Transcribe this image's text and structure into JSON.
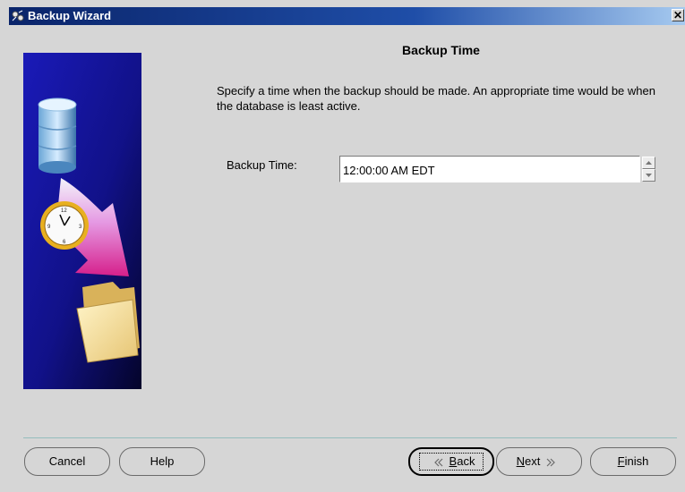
{
  "window": {
    "title": "Backup Wizard",
    "close_glyph": "✕"
  },
  "page": {
    "title": "Backup Time",
    "instructions": "Specify a time when the backup should be made. An appropriate time would be when the database is least active."
  },
  "backup_time": {
    "label": "Backup Time:",
    "value": "12:00:00 AM EDT"
  },
  "buttons": {
    "cancel": "Cancel",
    "help": "Help",
    "back": {
      "mnemonic": "B",
      "rest": "ack"
    },
    "next": {
      "mnemonic": "N",
      "rest": "ext"
    },
    "finish": {
      "mnemonic": "F",
      "rest": "inish"
    }
  },
  "icons": {
    "title": "backup-wizard-icon",
    "illustration": [
      "database-icon",
      "clock-icon",
      "arrow-icon",
      "folder-icon"
    ],
    "back": "chevron-left-icon",
    "next": "chevron-right-icon",
    "spin_up": "spin-up-icon",
    "spin_down": "spin-down-icon"
  },
  "colors": {
    "titlebar": "#0a246a",
    "background": "#d6d6d6",
    "separator": "#94bdbd"
  }
}
